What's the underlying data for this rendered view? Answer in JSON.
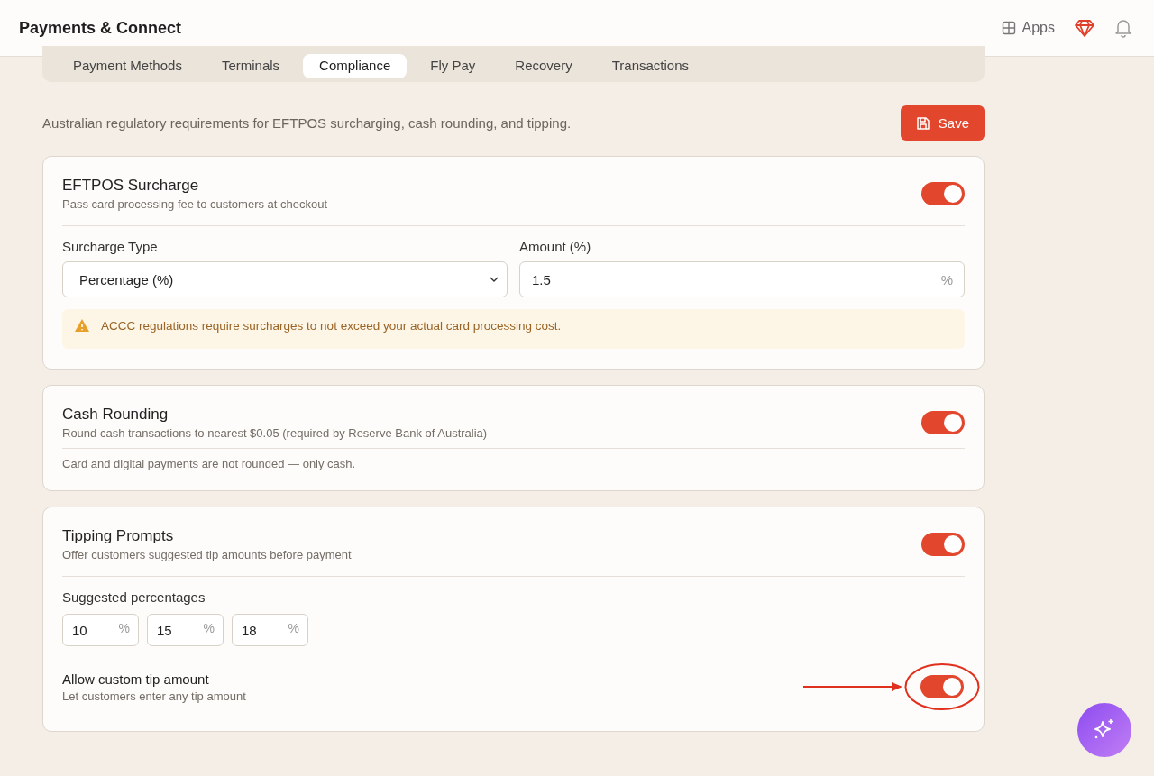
{
  "header": {
    "title": "Payments & Connect",
    "apps_label": "Apps"
  },
  "tabs": [
    {
      "label": "Payment Methods",
      "selected": false
    },
    {
      "label": "Terminals",
      "selected": false
    },
    {
      "label": "Compliance",
      "selected": true
    },
    {
      "label": "Fly Pay",
      "selected": false
    },
    {
      "label": "Recovery",
      "selected": false
    },
    {
      "label": "Transactions",
      "selected": false
    }
  ],
  "description": "Australian regulatory requirements for EFTPOS surcharging, cash rounding, and tipping.",
  "save_button": "Save",
  "surcharge": {
    "title": "EFTPOS Surcharge",
    "subtitle": "Pass card processing fee to customers at checkout",
    "on": true,
    "type_label": "Surcharge Type",
    "type_value": "Percentage (%)",
    "amount_label": "Amount (%)",
    "amount_value": "1.5",
    "amount_suffix": "%",
    "warning": "ACCC regulations require surcharges to not exceed your actual card processing cost."
  },
  "rounding": {
    "title": "Cash Rounding",
    "subtitle": "Round cash transactions to nearest $0.05 (required by Reserve Bank of Australia)",
    "on": true,
    "note": "Card and digital payments are not rounded — only cash."
  },
  "tipping": {
    "title": "Tipping Prompts",
    "subtitle": "Offer customers suggested tip amounts before payment",
    "on": true,
    "percent_label": "Suggested percentages",
    "percentages": [
      {
        "value": "10",
        "suffix": "%"
      },
      {
        "value": "15",
        "suffix": "%"
      },
      {
        "value": "18",
        "suffix": "%"
      }
    ],
    "custom_title": "Allow custom tip amount",
    "custom_subtitle": "Let customers enter any tip amount",
    "custom_on": true
  }
}
